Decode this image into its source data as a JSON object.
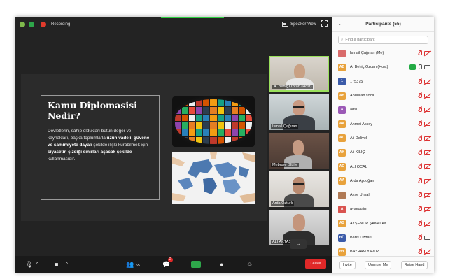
{
  "topbar": {
    "recording_label": "Recording",
    "speaker_view_label": "Speaker View"
  },
  "slide": {
    "title": "Kamu Diplomasisi Nedir?",
    "body_parts": [
      {
        "t": "Devletlerin, sahip oldukları bütün değer ve kaynakları, başka toplumlarla ",
        "b": false
      },
      {
        "t": "uzun vadeli",
        "b": true
      },
      {
        "t": ", ",
        "b": false
      },
      {
        "t": "güvene ve samimiyete dayalı",
        "b": true
      },
      {
        "t": " şekilde ilişki kurabilmek için ",
        "b": false
      },
      {
        "t": "siyasetin çizdiği sınırları aşacak şekilde",
        "b": true
      },
      {
        "t": " kullanmasıdır.",
        "b": false
      }
    ]
  },
  "tiles": [
    {
      "name": "A. Behiç Özcan (Host)",
      "active": true
    },
    {
      "name": "İsmail Çağıran",
      "active": false
    },
    {
      "name": "Mebrure BİLİM",
      "active": false
    },
    {
      "name": "Arda Özturk",
      "active": false
    },
    {
      "name": "ALİ AKTAŞ",
      "active": false
    }
  ],
  "toolbar": {
    "participants_count": "55",
    "chat_badge": "2",
    "leave_label": "Leave"
  },
  "panel": {
    "title": "Participants (55)",
    "search_placeholder": "Find a participant",
    "participants": [
      {
        "initials": "",
        "name": "İsmail Çağıran (Me)",
        "color": "#d96b6b",
        "photo": true,
        "mic": "off",
        "cam": "off"
      },
      {
        "initials": "AB",
        "name": "A. Behiç Özcan (Host)",
        "color": "#e8a23c",
        "photo": false,
        "mic": "on",
        "cam": "on",
        "badge": true
      },
      {
        "initials": "1",
        "name": "175375",
        "color": "#3b5ba9",
        "photo": false,
        "mic": "off",
        "cam": "off"
      },
      {
        "initials": "AB",
        "name": "Abdullah soca",
        "color": "#e8a23c",
        "photo": false,
        "mic": "off",
        "cam": "off"
      },
      {
        "initials": "A",
        "name": "adsu",
        "color": "#9b59b6",
        "photo": false,
        "mic": "off",
        "cam": "off"
      },
      {
        "initials": "AA",
        "name": "Ahmet Aksoy",
        "color": "#e8a23c",
        "photo": false,
        "mic": "off",
        "cam": "off"
      },
      {
        "initials": "AD",
        "name": "Ali Delivell",
        "color": "#e8a23c",
        "photo": false,
        "mic": "off",
        "cam": "off"
      },
      {
        "initials": "AK",
        "name": "Ali KILIÇ",
        "color": "#e8a23c",
        "photo": false,
        "mic": "off",
        "cam": "off"
      },
      {
        "initials": "AÖ",
        "name": "ALİ ÖCAL",
        "color": "#e8a23c",
        "photo": false,
        "mic": "off",
        "cam": "off"
      },
      {
        "initials": "AA",
        "name": "Arda Aydoğan",
        "color": "#e8a23c",
        "photo": false,
        "mic": "off",
        "cam": "off"
      },
      {
        "initials": "",
        "name": "Ayşe Ünsal",
        "color": "#b07a55",
        "photo": true,
        "mic": "off",
        "cam": "off"
      },
      {
        "initials": "A",
        "name": "ayseguljm",
        "color": "#d9534f",
        "photo": false,
        "mic": "off",
        "cam": "off"
      },
      {
        "initials": "AS",
        "name": "AYŞENUR ŞAKALAK",
        "color": "#e8a23c",
        "photo": false,
        "mic": "off",
        "cam": "off"
      },
      {
        "initials": "BÖ",
        "name": "Barış Özdarlı",
        "color": "#3b5ba9",
        "photo": false,
        "mic": "off",
        "cam": "on"
      },
      {
        "initials": "BY",
        "name": "BAYRAM YAVUZ",
        "color": "#e8a23c",
        "photo": false,
        "mic": "off",
        "cam": "off"
      }
    ],
    "footer": {
      "invite": "Invite",
      "unmute_me": "Unmute Me",
      "raise_hand": "Raise Hand"
    }
  },
  "colors": {
    "active_speaker_border": "#9be15d",
    "leave": "#e02828",
    "muted": "#d33333"
  }
}
